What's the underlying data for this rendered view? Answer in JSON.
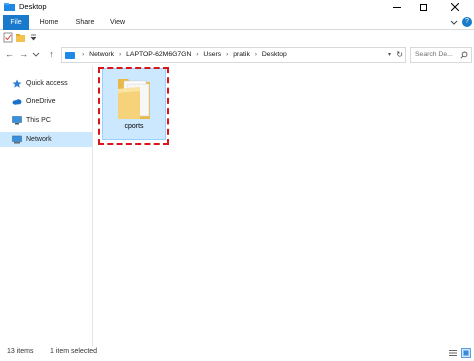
{
  "window": {
    "title": "Desktop"
  },
  "ribbon": {
    "tabs": [
      "File",
      "Home",
      "Share",
      "View"
    ],
    "help": "?"
  },
  "nav": {
    "back": "←",
    "forward": "→",
    "up": "↑"
  },
  "address": {
    "crumbs": [
      "Network",
      "LAPTOP-62M6G7GN",
      "Users",
      "pratik",
      "Desktop"
    ]
  },
  "search": {
    "placeholder": "Search De..."
  },
  "navpane": {
    "items": [
      {
        "label": "Quick access",
        "icon": "star-icon"
      },
      {
        "label": "OneDrive",
        "icon": "cloud-icon"
      },
      {
        "label": "This PC",
        "icon": "computer-icon"
      },
      {
        "label": "Network",
        "icon": "network-icon"
      }
    ]
  },
  "content": {
    "items": [
      {
        "name": "cports",
        "icon": "folder-icon"
      }
    ]
  },
  "status": {
    "count": "13 items",
    "selection": "1 item selected"
  },
  "colors": {
    "accent": "#1979ca",
    "selection": "#cce8ff",
    "highlight": "#d7151a"
  }
}
